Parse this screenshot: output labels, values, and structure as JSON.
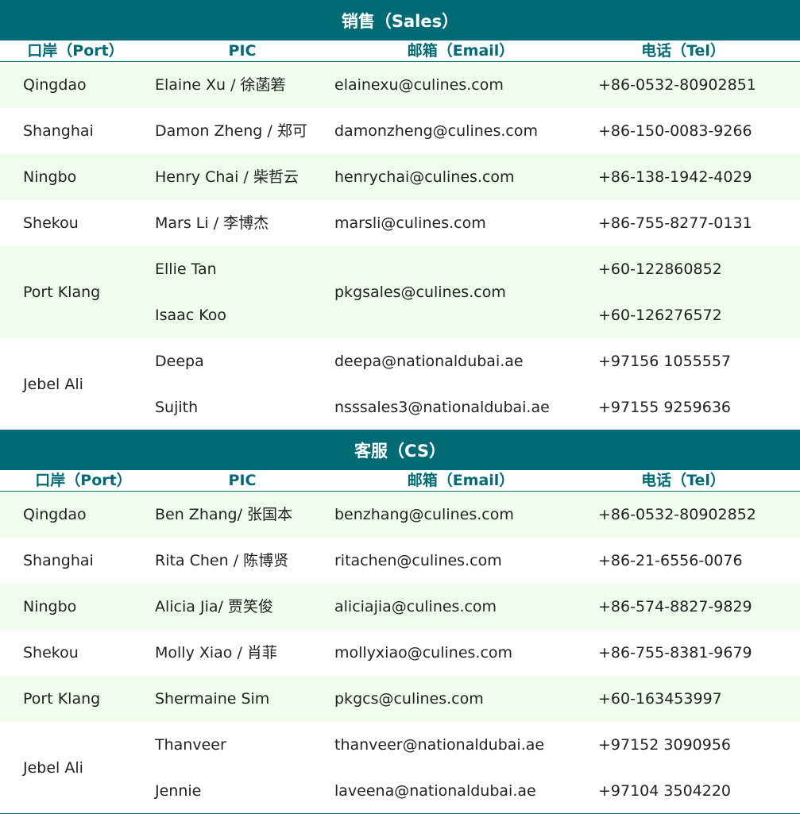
{
  "sections": [
    {
      "title": "销售（Sales）",
      "headers": {
        "port": "口岸（Port）",
        "pic": "PIC",
        "email": "邮箱（Email）",
        "tel": "电话（Tel）"
      },
      "rows": [
        {
          "port": "Qingdao",
          "pic": [
            "Elaine Xu / 徐菡箬"
          ],
          "email": [
            "elainexu@culines.com"
          ],
          "tel": [
            "+86-0532-80902851"
          ]
        },
        {
          "port": "Shanghai",
          "pic": [
            "Damon Zheng / 郑可"
          ],
          "email": [
            "damonzheng@culines.com"
          ],
          "tel": [
            "+86-150-0083-9266"
          ]
        },
        {
          "port": "Ningbo",
          "pic": [
            "Henry Chai / 柴哲云"
          ],
          "email": [
            "henrychai@culines.com"
          ],
          "tel": [
            "+86-138-1942-4029"
          ]
        },
        {
          "port": "Shekou",
          "pic": [
            "Mars Li / 李博杰"
          ],
          "email": [
            "marsli@culines.com"
          ],
          "tel": [
            "+86-755-8277-0131"
          ]
        },
        {
          "port": "Port Klang",
          "pic": [
            "Ellie Tan",
            "Isaac Koo"
          ],
          "email": [
            "pkgsales@culines.com"
          ],
          "tel": [
            "+60-122860852",
            "+60-126276572"
          ]
        },
        {
          "port": "Jebel Ali",
          "pic": [
            "Deepa",
            "Sujith"
          ],
          "email": [
            "deepa@nationaldubai.ae",
            "nsssales3@nationaldubai.ae"
          ],
          "tel": [
            "+97156 1055557",
            "+97155 9259636"
          ]
        }
      ]
    },
    {
      "title": "客服（CS）",
      "headers": {
        "port": "口岸（Port）",
        "pic": "PIC",
        "email": "邮箱（Email）",
        "tel": "电话（Tel）"
      },
      "rows": [
        {
          "port": "Qingdao",
          "pic": [
            "Ben Zhang/ 张国本"
          ],
          "email": [
            "benzhang@culines.com"
          ],
          "tel": [
            "+86-0532-80902852"
          ]
        },
        {
          "port": "Shanghai",
          "pic": [
            "Rita Chen / 陈博贤"
          ],
          "email": [
            "ritachen@culines.com"
          ],
          "tel": [
            "+86-21-6556-0076"
          ]
        },
        {
          "port": "Ningbo",
          "pic": [
            "Alicia Jia/ 贾笑俊"
          ],
          "email": [
            "aliciajia@culines.com"
          ],
          "tel": [
            "+86-574-8827-9829"
          ]
        },
        {
          "port": "Shekou",
          "pic": [
            "Molly Xiao / 肖菲"
          ],
          "email": [
            "mollyxiao@culines.com"
          ],
          "tel": [
            "+86-755-8381-9679"
          ]
        },
        {
          "port": "Port Klang",
          "pic": [
            "Shermaine Sim"
          ],
          "email": [
            "pkgcs@culines.com"
          ],
          "tel": [
            "+60-163453997"
          ]
        },
        {
          "port": "Jebel Ali",
          "pic": [
            "Thanveer",
            "Jennie"
          ],
          "email": [
            "thanveer@nationaldubai.ae",
            "laveena@nationaldubai.ae"
          ],
          "tel": [
            "+97152 3090956",
            "+97104 3504220"
          ]
        }
      ]
    }
  ]
}
